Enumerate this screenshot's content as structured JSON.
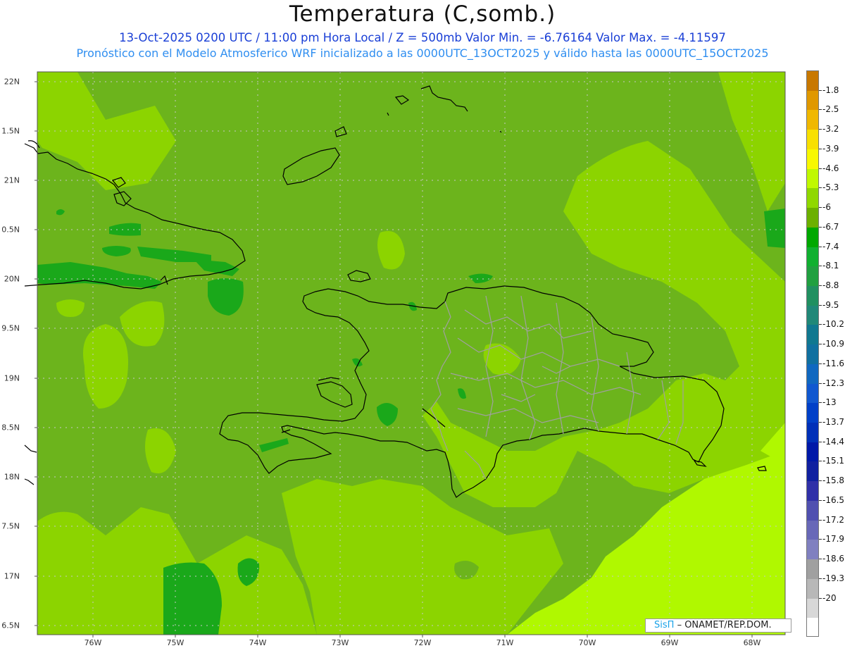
{
  "header": {
    "title": "Temperatura (C,somb.)",
    "subtitle_line1": "13-Oct-2025  0200 UTC / 11:00 pm Hora Local / Z = 500mb  Valor Min. = -6.76164  Valor Max. = -4.11597",
    "subtitle_line2": "Pronóstico con el Modelo Atmosferico WRF inicializado a las 0000UTC_13OCT2025 y válido hasta las  0000UTC_15OCT2025"
  },
  "axes": {
    "lat_labels": [
      "22N",
      "1.5N",
      "21N",
      "0.5N",
      "20N",
      "9.5N",
      "19N",
      "8.5N",
      "18N",
      "7.5N",
      "17N",
      "6.5N"
    ],
    "lon_labels": [
      "76W",
      "75W",
      "74W",
      "73W",
      "72W",
      "71W",
      "70W",
      "69W",
      "68W"
    ]
  },
  "colorbar": {
    "labels": [
      "-1.8",
      "-2.5",
      "-3.2",
      "-3.9",
      "-4.6",
      "-5.3",
      "-6",
      "-6.7",
      "-7.4",
      "-8.1",
      "-8.8",
      "-9.5",
      "-10.2",
      "-10.9",
      "-11.6",
      "-12.3",
      "-13",
      "-13.7",
      "-14.4",
      "-15.1",
      "-15.8",
      "-16.5",
      "-17.2",
      "-17.9",
      "-18.6",
      "-19.3",
      "-20"
    ],
    "colors": [
      "#c87800",
      "#e09800",
      "#f0b800",
      "#f8e000",
      "#f8f800",
      "#c0f800",
      "#90d800",
      "#6cb000",
      "#00a800",
      "#10b030",
      "#20a040",
      "#209060",
      "#208878",
      "#107890",
      "#1070a0",
      "#1068c0",
      "#1058d0",
      "#0040c8",
      "#0030b8",
      "#0018a8",
      "#1020a0",
      "#3030a8",
      "#5050b0",
      "#6868b8",
      "#8080c0",
      "#a0a0a0",
      "#b8b8b8",
      "#d8d8d8",
      "#ffffff"
    ]
  },
  "field_colors": {
    "base": "#6cb41c",
    "light": "#8cd400",
    "yellowgreen": "#b0f800",
    "dark": "#1aa81a",
    "land_outline": "#000000",
    "province_lines": "#a0a0a0",
    "gridlines": "#c8c8c8"
  },
  "credit": {
    "brand": "SisΠ",
    "text": "– ONAMET/REP.DOM."
  }
}
